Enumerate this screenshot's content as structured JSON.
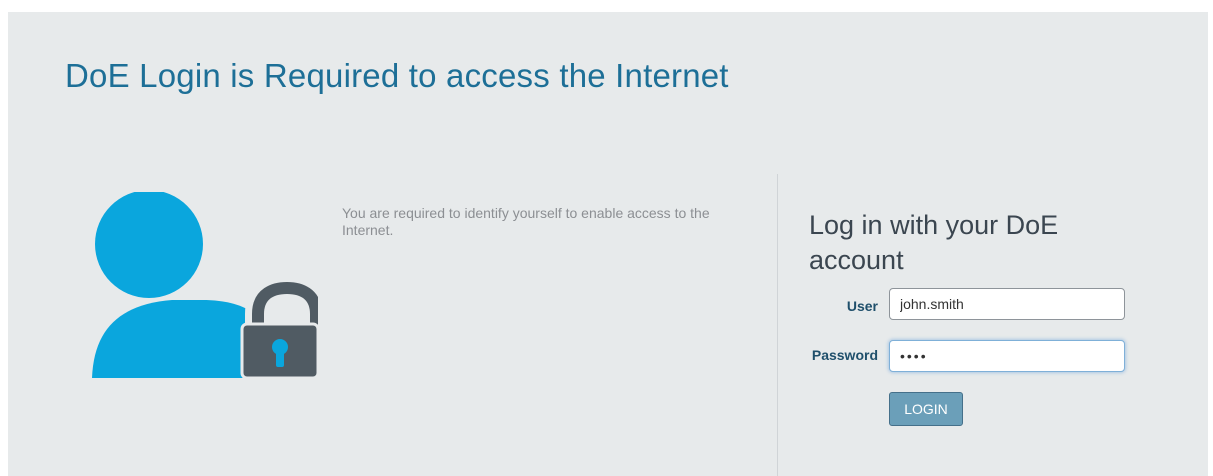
{
  "header": {
    "title": "DoE Login is Required to access the Internet"
  },
  "info": {
    "message": "You are required to identify yourself to enable access to the Internet."
  },
  "login_form": {
    "heading": "Log in with your DoE account",
    "user_label": "User",
    "user_value": "john.smith",
    "password_label": "Password",
    "password_value": "••••",
    "submit_label": "LOGIN"
  },
  "icons": {
    "illustration": "user-lock-icon",
    "person_color": "#0aa6dd",
    "lock_color": "#505b63"
  },
  "colors": {
    "background": "#e7eaeb",
    "title": "#1d6f97",
    "button": "#6b9fb9"
  }
}
